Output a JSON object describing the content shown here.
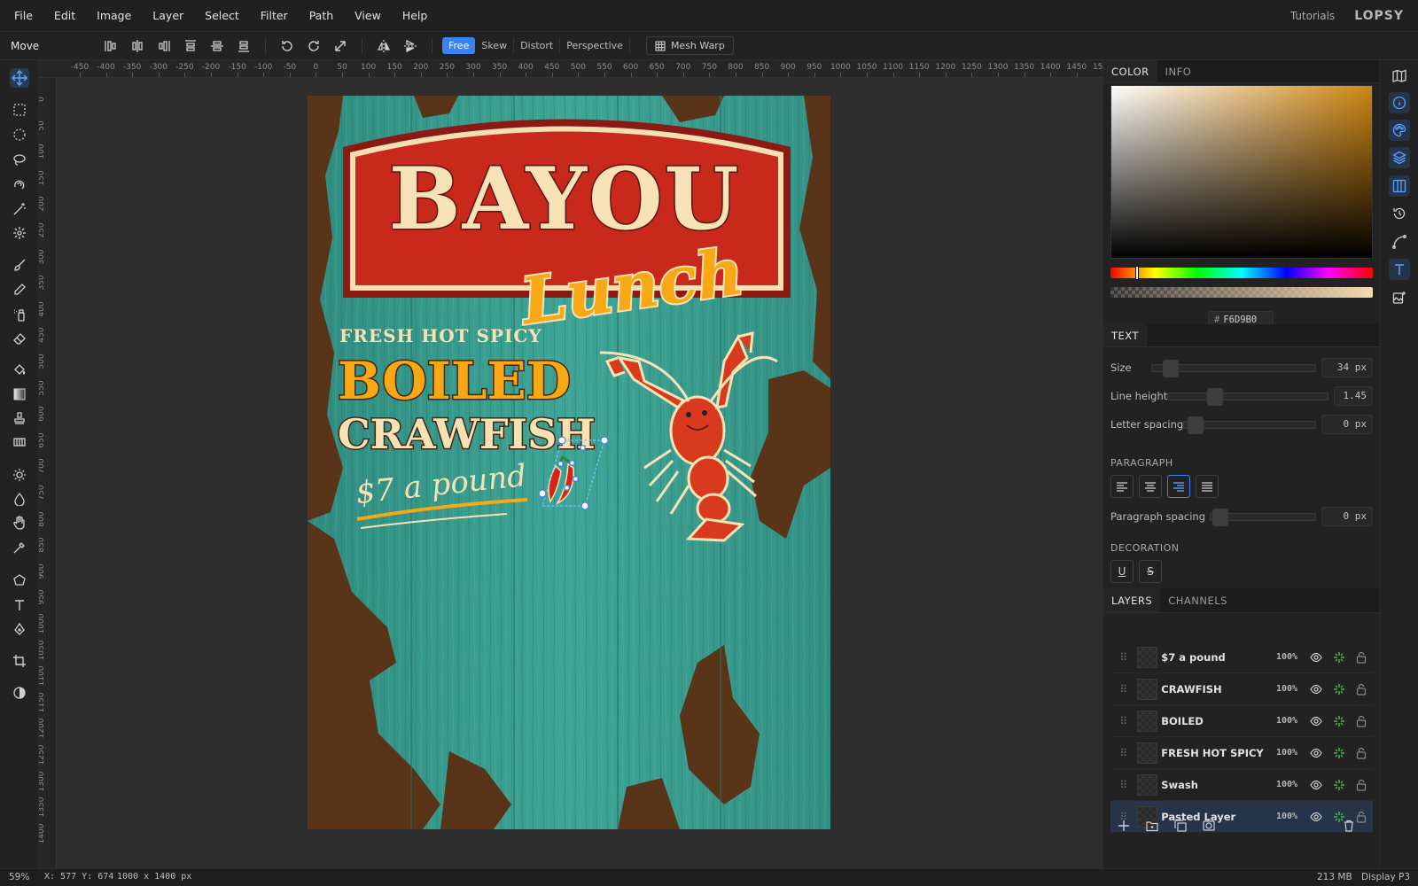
{
  "menubar": {
    "items": [
      "File",
      "Edit",
      "Image",
      "Layer",
      "Select",
      "Filter",
      "Path",
      "View",
      "Help"
    ],
    "tutorials": "Tutorials",
    "logo": "LOPSY"
  },
  "toolbar": {
    "tool_name": "Move",
    "modes": [
      "Free",
      "Skew",
      "Distort",
      "Perspective"
    ],
    "active_mode": "Free",
    "mesh_warp": "Mesh Warp"
  },
  "ruler": {
    "h_labels": [
      "-450",
      "-400",
      "-350",
      "-300",
      "-250",
      "-200",
      "-150",
      "-100",
      "-50",
      "0",
      "50",
      "100",
      "150",
      "200",
      "250",
      "300",
      "350",
      "400",
      "450",
      "500",
      "550",
      "600",
      "650",
      "700",
      "750",
      "800",
      "850",
      "900",
      "950",
      "1000",
      "1050",
      "1100",
      "1150",
      "1200",
      "1250",
      "1300",
      "1350",
      "1400",
      "1450",
      "1500"
    ],
    "v_labels": [
      "0",
      "50",
      "100",
      "150",
      "200",
      "250",
      "300",
      "350",
      "400",
      "450",
      "500",
      "550",
      "600",
      "650",
      "700",
      "750",
      "800",
      "850",
      "900",
      "950",
      "1000",
      "1050",
      "1100",
      "1150",
      "1200",
      "1250",
      "1300",
      "1350",
      "1400"
    ]
  },
  "poster": {
    "title": "BAYOU",
    "script": "Lunch",
    "tagline": "FRESH HOT SPICY",
    "line1": "BOILED",
    "line2": "CRAWFISH",
    "price": "$7 a pound"
  },
  "color_panel": {
    "tabs": [
      "COLOR",
      "INFO"
    ],
    "hex_prefix": "#",
    "hex": "F6D9B0"
  },
  "text_panel": {
    "title": "TEXT",
    "size_label": "Size",
    "size_value": "34 px",
    "line_height_label": "Line height",
    "line_height_value": "1.45",
    "letter_spacing_label": "Letter spacing",
    "letter_spacing_value": "0 px",
    "paragraph_header": "PARAGRAPH",
    "paragraph_spacing_label": "Paragraph spacing",
    "paragraph_spacing_value": "0 px",
    "decoration_header": "DECORATION",
    "underline": "U",
    "strike": "S"
  },
  "layers_panel": {
    "tabs": [
      "LAYERS",
      "CHANNELS"
    ],
    "layers": [
      {
        "name": "$7 a pound",
        "opacity": "100%"
      },
      {
        "name": "CRAWFISH",
        "opacity": "100%"
      },
      {
        "name": "BOILED",
        "opacity": "100%"
      },
      {
        "name": "FRESH HOT SPICY",
        "opacity": "100%"
      },
      {
        "name": "Swash",
        "opacity": "100%"
      },
      {
        "name": "Pasted Layer",
        "opacity": "100%"
      }
    ]
  },
  "status": {
    "zoom": "59%",
    "coords": "X: 577  Y: 674",
    "dimensions": "1000 x 1400 px",
    "memory": "213 MB",
    "profile": "Display P3"
  },
  "colors": {
    "accent": "#3b82f6",
    "teal": "#3a9a8c",
    "wood": "#5a3418",
    "sign_red": "#c9281c",
    "cream": "#f6e2b4",
    "yellow": "#f7a814"
  }
}
